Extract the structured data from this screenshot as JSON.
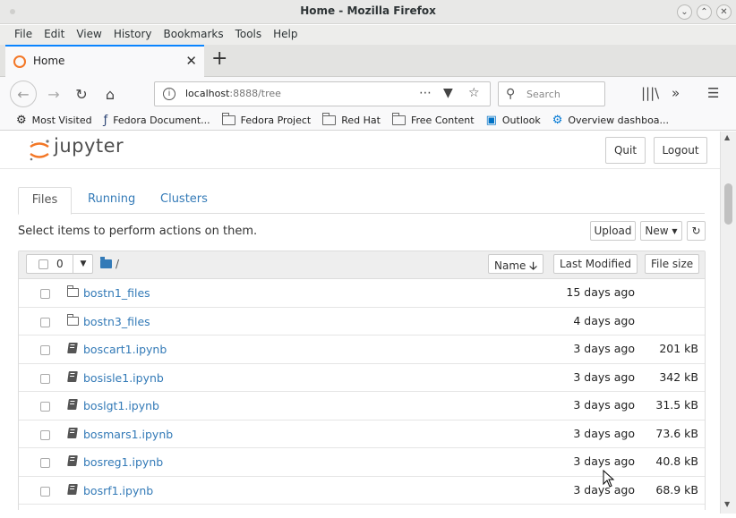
{
  "window": {
    "title": "Home - Mozilla Firefox"
  },
  "menubar": [
    "File",
    "Edit",
    "View",
    "History",
    "Bookmarks",
    "Tools",
    "Help"
  ],
  "tab": {
    "label": "Home"
  },
  "urlbar": {
    "host": "localhost",
    "port_path": ":8888/tree"
  },
  "searchbar": {
    "placeholder": "Search"
  },
  "bookmarks": [
    "Most Visited",
    "Fedora Document...",
    "Fedora Project",
    "Red Hat",
    "Free Content",
    "Outlook",
    "Overview dashboa..."
  ],
  "jupyter": {
    "brand": "jupyter",
    "quit_label": "Quit",
    "logout_label": "Logout",
    "tabs": [
      "Files",
      "Running",
      "Clusters"
    ],
    "instructions": "Select items to perform actions on them.",
    "upload_label": "Upload",
    "new_label": "New",
    "selected_count": "0",
    "breadcrumb": "/",
    "columns": {
      "name": "Name",
      "last_modified": "Last Modified",
      "file_size": "File size"
    },
    "files": [
      {
        "type": "folder",
        "name": "bostn1_files",
        "modified": "15 days ago",
        "size": ""
      },
      {
        "type": "folder",
        "name": "bostn3_files",
        "modified": "4 days ago",
        "size": ""
      },
      {
        "type": "notebook",
        "name": "boscart1.ipynb",
        "modified": "3 days ago",
        "size": "201 kB"
      },
      {
        "type": "notebook",
        "name": "bosisle1.ipynb",
        "modified": "3 days ago",
        "size": "342 kB"
      },
      {
        "type": "notebook",
        "name": "boslgt1.ipynb",
        "modified": "3 days ago",
        "size": "31.5 kB"
      },
      {
        "type": "notebook",
        "name": "bosmars1.ipynb",
        "modified": "3 days ago",
        "size": "73.6 kB"
      },
      {
        "type": "notebook",
        "name": "bosreg1.ipynb",
        "modified": "3 days ago",
        "size": "40.8 kB"
      },
      {
        "type": "notebook",
        "name": "bosrf1.ipynb",
        "modified": "3 days ago",
        "size": "68.9 kB"
      }
    ]
  },
  "colors": {
    "link": "#337ab7",
    "brand_orange": "#f37726",
    "tab_accent": "#0a84ff"
  }
}
